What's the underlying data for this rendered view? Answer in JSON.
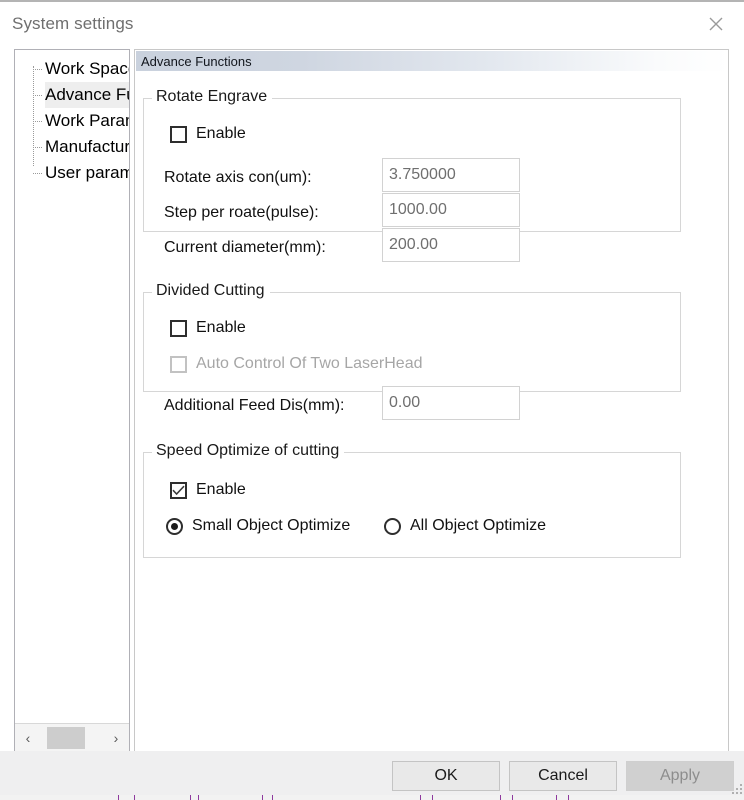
{
  "window": {
    "title": "System settings",
    "close_icon": "close-icon"
  },
  "sidebar": {
    "items": [
      {
        "label": "Work Space",
        "selected": false
      },
      {
        "label": "Advance Fu",
        "selected": true
      },
      {
        "label": "Work Param",
        "selected": false
      },
      {
        "label": "Manufactur",
        "selected": false
      },
      {
        "label": "User param",
        "selected": false
      }
    ],
    "scrollbar": {
      "left_arrow": "‹",
      "right_arrow": "›"
    }
  },
  "main": {
    "section_title": "Advance Functions",
    "groups": [
      {
        "title": "Rotate Engrave",
        "enable": {
          "label": "Enable",
          "checked": false,
          "disabled": false
        },
        "fields": [
          {
            "label": "Rotate axis con(um):",
            "value": "3.750000"
          },
          {
            "label": "Step per roate(pulse):",
            "value": "1000.00"
          },
          {
            "label": "Current diameter(mm):",
            "value": "200.00"
          }
        ]
      },
      {
        "title": "Divided Cutting",
        "enable": {
          "label": "Enable",
          "checked": false,
          "disabled": false
        },
        "secondary_check": {
          "label": "Auto Control Of Two LaserHead",
          "checked": false,
          "disabled": true
        },
        "fields": [
          {
            "label": "Additional Feed Dis(mm):",
            "value": "0.00"
          }
        ]
      },
      {
        "title": "Speed Optimize of cutting",
        "enable": {
          "label": "Enable",
          "checked": true,
          "disabled": false
        },
        "radios": [
          {
            "label": "Small Object Optimize",
            "selected": true
          },
          {
            "label": "All Object Optimize",
            "selected": false
          }
        ]
      }
    ]
  },
  "footer": {
    "ok_label": "OK",
    "cancel_label": "Cancel",
    "apply_label": "Apply",
    "apply_disabled": true
  }
}
